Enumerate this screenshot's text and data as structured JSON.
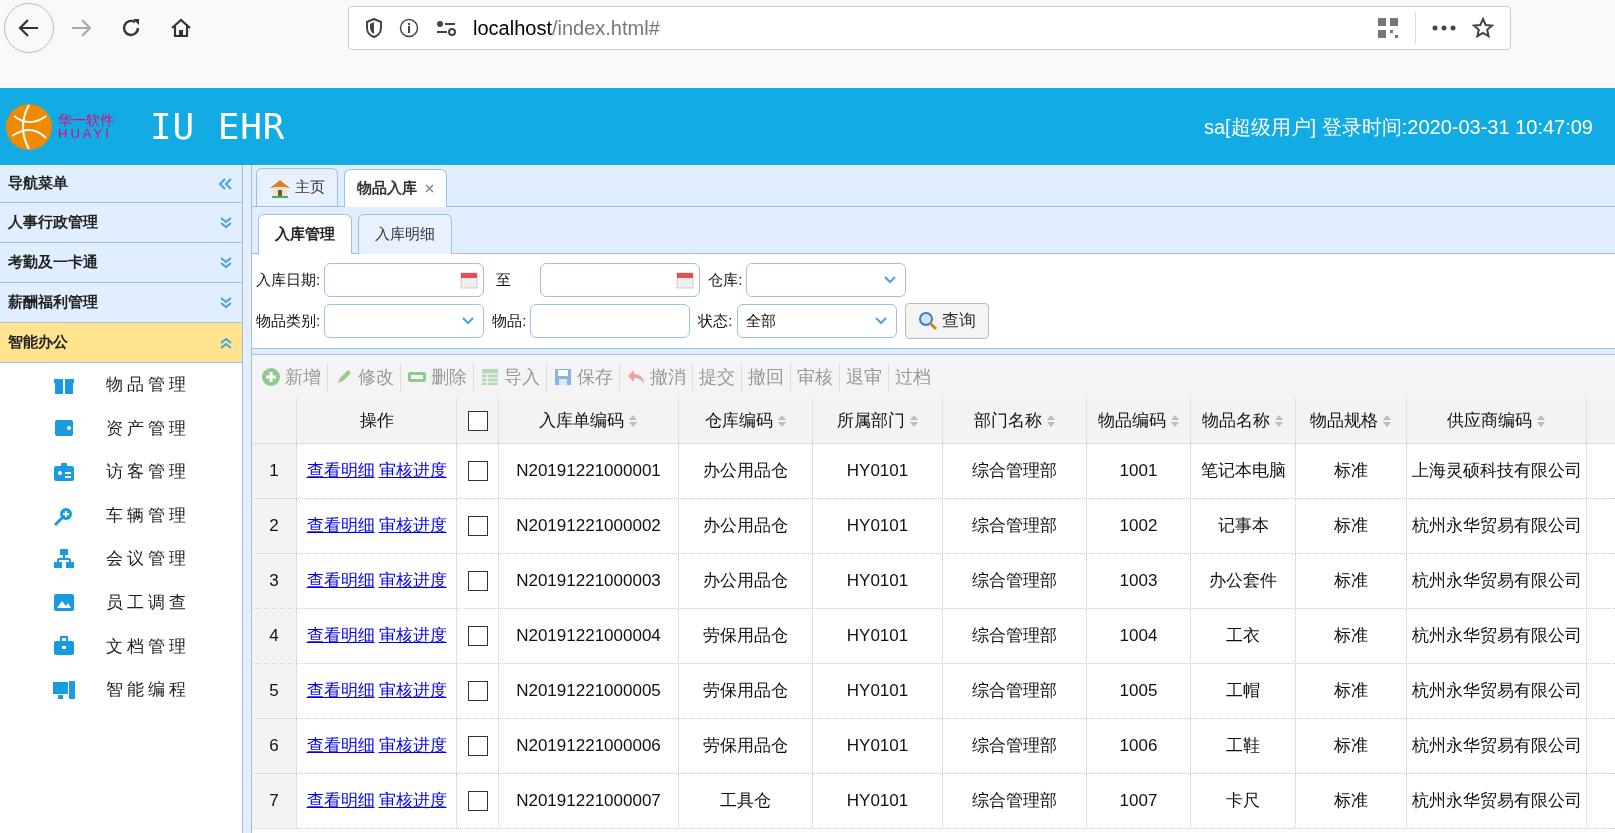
{
  "browser": {
    "url_host": "localhost",
    "url_path": "/index.html#"
  },
  "header": {
    "logo_cn": "华一软件",
    "logo_en": "HUAYI",
    "title": "IU EHR",
    "user": "sa",
    "role": "[超级用户]",
    "login_label": "登录时间:",
    "login_time": "2020-03-31 10:47:09"
  },
  "sidebar": {
    "title": "导航菜单",
    "groups": [
      {
        "label": "人事行政管理",
        "expanded": false
      },
      {
        "label": "考勤及一卡通",
        "expanded": false
      },
      {
        "label": "薪酬福利管理",
        "expanded": false
      },
      {
        "label": "智能办公",
        "expanded": true,
        "children": [
          {
            "label": "物品管理",
            "kind": "gift"
          },
          {
            "label": "资产管理",
            "kind": "wallet"
          },
          {
            "label": "访客管理",
            "kind": "badge"
          },
          {
            "label": "车辆管理",
            "kind": "zoom"
          },
          {
            "label": "会议管理",
            "kind": "org"
          },
          {
            "label": "员工调查",
            "kind": "picture"
          },
          {
            "label": "文档管理",
            "kind": "briefcase"
          },
          {
            "label": "智能编程",
            "kind": "computer"
          }
        ]
      }
    ]
  },
  "tabs": [
    {
      "label": "主页",
      "selected": false
    },
    {
      "label": "物品入库",
      "selected": true
    }
  ],
  "subtabs": [
    {
      "label": "入库管理",
      "selected": true
    },
    {
      "label": "入库明细",
      "selected": false
    }
  ],
  "filters": {
    "date_label": "入库日期:",
    "to_label": "至",
    "warehouse_label": "仓库:",
    "category_label": "物品类别:",
    "item_label": "物品:",
    "status_label": "状态:",
    "status_value": "全部",
    "search_button": "查询"
  },
  "toolbar": [
    "新增",
    "修改",
    "删除",
    "导入",
    "保存",
    "撤消",
    "提交",
    "撤回",
    "审核",
    "退审",
    "过档"
  ],
  "table": {
    "action_column": "操作",
    "header_checked": false,
    "columns": [
      "入库单编码",
      "仓库编码",
      "所属部门",
      "部门名称",
      "物品编码",
      "物品名称",
      "物品规格",
      "供应商编码"
    ],
    "rows": [
      {
        "num": "1",
        "links": [
          "查看明细",
          "审核进度"
        ],
        "checked": false,
        "cells": [
          "N20191221000001",
          "办公用品仓",
          "HY0101",
          "综合管理部",
          "1001",
          "笔记本电脑",
          "标准",
          "上海灵硕科技有限公司"
        ]
      },
      {
        "num": "2",
        "links": [
          "查看明细",
          "审核进度"
        ],
        "checked": false,
        "cells": [
          "N20191221000002",
          "办公用品仓",
          "HY0101",
          "综合管理部",
          "1002",
          "记事本",
          "标准",
          "杭州永华贸易有限公司"
        ]
      },
      {
        "num": "3",
        "links": [
          "查看明细",
          "审核进度"
        ],
        "checked": false,
        "cells": [
          "N20191221000003",
          "办公用品仓",
          "HY0101",
          "综合管理部",
          "1003",
          "办公套件",
          "标准",
          "杭州永华贸易有限公司"
        ]
      },
      {
        "num": "4",
        "links": [
          "查看明细",
          "审核进度"
        ],
        "checked": false,
        "cells": [
          "N20191221000004",
          "劳保用品仓",
          "HY0101",
          "综合管理部",
          "1004",
          "工衣",
          "标准",
          "杭州永华贸易有限公司"
        ]
      },
      {
        "num": "5",
        "links": [
          "查看明细",
          "审核进度"
        ],
        "checked": false,
        "cells": [
          "N20191221000005",
          "劳保用品仓",
          "HY0101",
          "综合管理部",
          "1005",
          "工帽",
          "标准",
          "杭州永华贸易有限公司"
        ]
      },
      {
        "num": "6",
        "links": [
          "查看明细",
          "审核进度"
        ],
        "checked": false,
        "cells": [
          "N20191221000006",
          "劳保用品仓",
          "HY0101",
          "综合管理部",
          "1006",
          "工鞋",
          "标准",
          "杭州永华贸易有限公司"
        ]
      },
      {
        "num": "7",
        "links": [
          "查看明细",
          "审核进度"
        ],
        "checked": false,
        "cells": [
          "N20191221000007",
          "工具仓",
          "HY0101",
          "综合管理部",
          "1007",
          "卡尺",
          "标准",
          "杭州永华贸易有限公司"
        ]
      }
    ]
  }
}
